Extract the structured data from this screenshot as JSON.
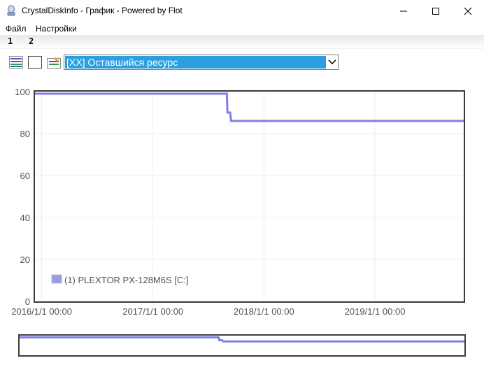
{
  "window": {
    "title": "CrystalDiskInfo - График - Powered by Flot",
    "minimize_label": "—",
    "maximize_label": "☐",
    "close_label": "✕"
  },
  "menu": {
    "items": [
      {
        "label": "Файл"
      },
      {
        "label": "Настройки"
      }
    ]
  },
  "tabs": [
    {
      "label": "1"
    },
    {
      "label": "2"
    }
  ],
  "toolbar": {
    "selected_attribute": "[XX] Оставшийся ресурс",
    "icons": [
      "multi-graph-icon",
      "blank-graph-icon",
      "clear-graph-icon"
    ]
  },
  "colors": {
    "series": "#8080e0",
    "accent_select": "#2d9fe0"
  },
  "chart_data": {
    "type": "line",
    "ylim": [
      0,
      100
    ],
    "yticks": [
      "0",
      "20",
      "40",
      "60",
      "80",
      "100"
    ],
    "xticks": [
      "2016/1/1 00:00",
      "2017/1/1 00:00",
      "2018/1/1 00:00",
      "2019/1/1 00:00"
    ],
    "xlim": [
      "2015-12-10",
      "2019-10-20"
    ],
    "grid": true,
    "legend_position": "bottom-left",
    "series": [
      {
        "name": "(1) PLEXTOR PX-128M6S [C:]",
        "points": [
          [
            "2015-12-10",
            99
          ],
          [
            "2017-09-01",
            99
          ],
          [
            "2017-09-03",
            90
          ],
          [
            "2017-09-12",
            90
          ],
          [
            "2017-09-15",
            86
          ],
          [
            "2019-10-20",
            86
          ]
        ]
      }
    ]
  }
}
